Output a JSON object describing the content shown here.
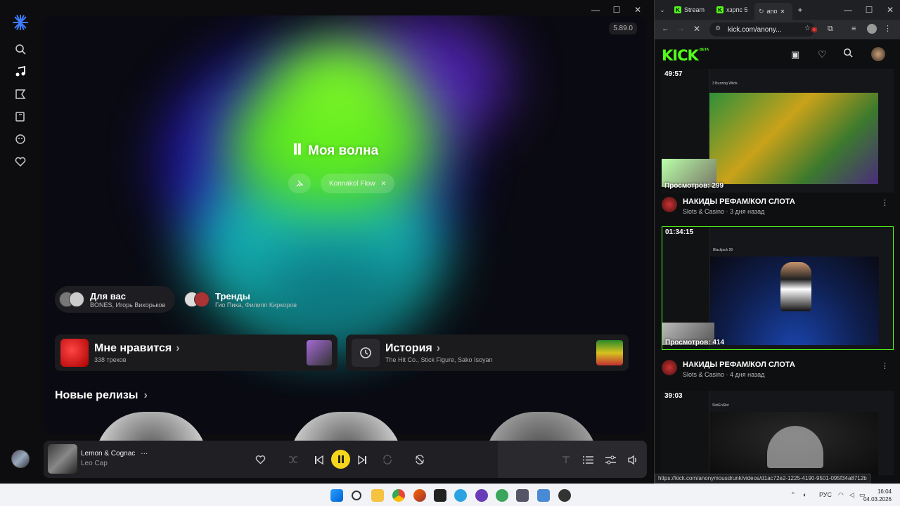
{
  "music_app": {
    "version": "5.89.0",
    "wave": {
      "title": "Моя волна",
      "chip": "Konnakol Flow",
      "chip_close": "✕"
    },
    "pills": [
      {
        "title": "Для вас",
        "subtitle": "BONES, Игорь Вихорьков"
      },
      {
        "title": "Тренды",
        "subtitle": "Гио Пика, Филипп Киркоров"
      }
    ],
    "cards": [
      {
        "title": "Мне нравится",
        "chevron": "›",
        "subtitle": "338 треков"
      },
      {
        "title": "История",
        "chevron": "›",
        "subtitle": "The Hit Co., Stick Figure, Sako Isoyan"
      }
    ],
    "new_releases": {
      "title": "Новые релизы",
      "chevron": "›"
    },
    "player": {
      "track": "Lemon & Cognac",
      "more": "···",
      "artist": "Leo Cap"
    },
    "window_controls": {
      "minimize": "—",
      "maximize": "☐",
      "close": "✕"
    },
    "colors": {
      "accent": "#f5d61d",
      "bg": "#0d0d0f"
    }
  },
  "browser": {
    "tabs": [
      {
        "label": "Stream",
        "favicon": "K"
      },
      {
        "label": "хзрпс 5",
        "favicon": "K"
      },
      {
        "label": "ano",
        "active": true
      }
    ],
    "window_controls": {
      "minimize": "—",
      "maximize": "☐",
      "close": "✕"
    },
    "address": "kick.com/anony...",
    "logo": "KICK",
    "beta": "BETA",
    "videos": [
      {
        "duration": "49:57",
        "views": "Просмотров: 299",
        "title": "НАКИДЫ РЕФАМ/КОЛ СЛОТА",
        "category": "Slots & Casino",
        "age": "3 дня назад",
        "game": "3 Buzzing Wilds"
      },
      {
        "duration": "01:34:15",
        "views": "Просмотров: 414",
        "title": "НАКИДЫ РЕФАМ/КОЛ СЛОТА",
        "category": "Slots & Casino",
        "age": "4 дня назад",
        "game": "Blackjack 28"
      },
      {
        "duration": "39:03",
        "game": "SlotEnSlot"
      }
    ],
    "status_url": "https://kick.com/anonymousdrunk/videos/d1ac72e2-1225-4190-9501-095f34a8712b",
    "colors": {
      "kick_green": "#53fc18"
    }
  },
  "taskbar": {
    "language": "РУС",
    "time": "16:04",
    "date": "04.03.2026"
  }
}
